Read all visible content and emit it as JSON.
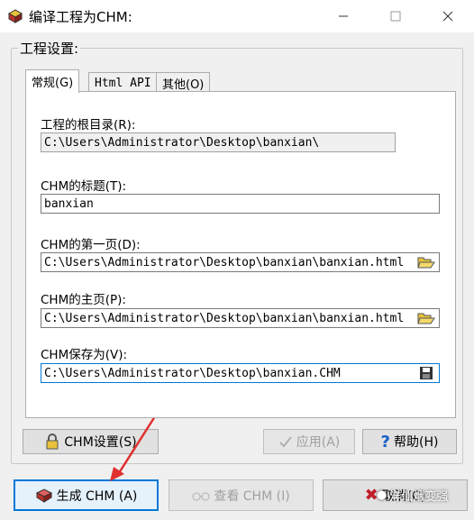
{
  "window": {
    "title": "编译工程为CHM:"
  },
  "group": {
    "label": "工程设置:"
  },
  "tabs": [
    {
      "label": "常规(G)"
    },
    {
      "label": "Html API"
    },
    {
      "label": "其他(O)"
    }
  ],
  "fields": {
    "root_dir": {
      "label": "工程的根目录(R):",
      "value": "C:\\Users\\Administrator\\Desktop\\banxian\\"
    },
    "chm_title": {
      "label": "CHM的标题(T):",
      "value": "banxian"
    },
    "first_page": {
      "label": "CHM的第一页(D):",
      "value": "C:\\Users\\Administrator\\Desktop\\banxian\\banxian.html"
    },
    "home_page": {
      "label": "CHM的主页(P):",
      "value": "C:\\Users\\Administrator\\Desktop\\banxian\\banxian.html"
    },
    "save_as": {
      "label": "CHM保存为(V):",
      "value": "C:\\Users\\Administrator\\Desktop\\banxian.CHM"
    }
  },
  "buttons": {
    "chm_settings": "CHM设置(S)",
    "apply": "应用(A)",
    "help": "帮助(H)",
    "generate": "生成 CHM (A)",
    "view": "查看 CHM (I)",
    "cancel": "取消(C)"
  },
  "watermark": "洋仙烟变强"
}
